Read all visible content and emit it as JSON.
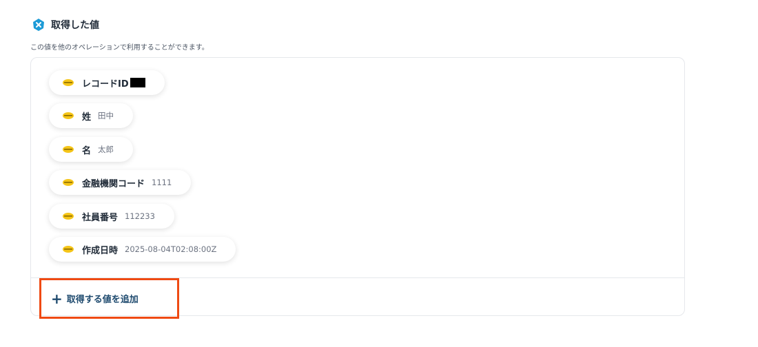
{
  "section": {
    "title": "取得した値",
    "description": "この値を他のオペレーションで利用することができます。",
    "icon": "yoom-x-badge-icon"
  },
  "fields": [
    {
      "label": "レコードID",
      "value": "",
      "redacted": true
    },
    {
      "label": "姓",
      "value": "田中"
    },
    {
      "label": "名",
      "value": "太郎"
    },
    {
      "label": "金融機関コード",
      "value": "1111"
    },
    {
      "label": "社員番号",
      "value": "112233"
    },
    {
      "label": "作成日時",
      "value": "2025-08-04T02:08:00Z"
    }
  ],
  "add_button": {
    "label": "取得する値を追加",
    "icon": "plus-icon"
  },
  "colors": {
    "chip_icon": "#f5c518",
    "header_icon": "#1d9bd7",
    "add_text": "#1e4a6e",
    "highlight_border": "#ef4a13"
  }
}
